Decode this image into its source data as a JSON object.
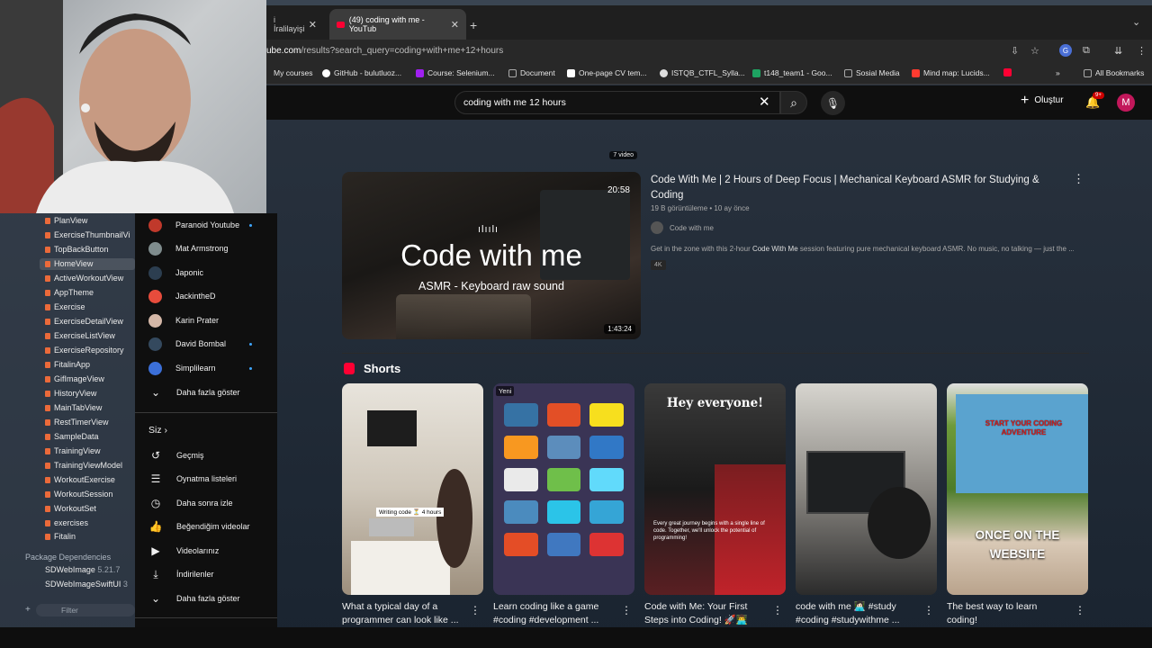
{
  "browser": {
    "tabs": [
      {
        "label": "i İralilayişi"
      },
      {
        "label": "(49) coding with me - YouTub"
      }
    ],
    "url_prefix": "ube.com",
    "url_rest": "/results?search_query=coding+with+me+12+hours",
    "bookmarks": [
      {
        "label": "My courses",
        "color": "#c7c7c7"
      },
      {
        "label": "GitHub - bulutluoz...",
        "color": "#ffffff"
      },
      {
        "label": "Course: Selenium...",
        "color": "#a020f0"
      },
      {
        "label": "Document",
        "color": "#888888"
      },
      {
        "label": "One-page CV tem...",
        "color": "#ffffff"
      },
      {
        "label": "ISTQB_CTFL_Sylla...",
        "color": "#e0e0e0"
      },
      {
        "label": "t148_team1 - Goo...",
        "color": "#1ea362"
      },
      {
        "label": "Sosial Media",
        "color": "#888888"
      },
      {
        "label": "Mind map: Lucids...",
        "color": "#ff3b30"
      },
      {
        "label": "All Bookmarks",
        "color": "#888888"
      }
    ]
  },
  "header": {
    "search_value": "coding with me 12 hours",
    "create_label": "Oluştur",
    "notif_count": "9+",
    "account_initial": "M"
  },
  "xcode": {
    "items": [
      "PlanView",
      "ExerciseThumbnailVi",
      "TopBackButton",
      "HomeView",
      "ActiveWorkoutView",
      "AppTheme",
      "Exercise",
      "ExerciseDetailView",
      "ExerciseListView",
      "ExerciseRepository",
      "FitalinApp",
      "GifImageView",
      "HistoryView",
      "MainTabView",
      "RestTimerView",
      "SampleData",
      "TrainingView",
      "TrainingViewModel",
      "WorkoutExercise",
      "WorkoutSession",
      "WorkoutSet",
      "exercises",
      "Fitalin"
    ],
    "package_deps_label": "Package Dependencies",
    "packages": [
      {
        "name": "SDWebImage",
        "version": "5.21.7"
      },
      {
        "name": "SDWebImageSwiftUI",
        "version": "3"
      }
    ],
    "filter_placeholder": "Filter"
  },
  "sidebar": {
    "subscriptions": [
      {
        "label": "Paranoid Youtube",
        "color": "#c0392b",
        "dot": true
      },
      {
        "label": "Mat Armstrong",
        "color": "#7f8c8d",
        "dot": false
      },
      {
        "label": "Japonic",
        "color": "#2c3e50",
        "dot": false
      },
      {
        "label": "JackintheD",
        "color": "#e74c3c",
        "dot": false
      },
      {
        "label": "Karin Prater",
        "color": "#d5b8a8",
        "dot": false
      },
      {
        "label": "David Bombal",
        "color": "#34495e",
        "dot": true
      },
      {
        "label": "Simplilearn",
        "color": "#3b6fd8",
        "dot": true
      }
    ],
    "show_more": "Daha fazla göster",
    "you_label": "Siz",
    "you_items": [
      {
        "label": "Geçmiş",
        "icon": "history-icon"
      },
      {
        "label": "Oynatma listeleri",
        "icon": "playlist-icon"
      },
      {
        "label": "Daha sonra izle",
        "icon": "clock-icon"
      },
      {
        "label": "Beğendiğim videolar",
        "icon": "thumbs-up-icon"
      },
      {
        "label": "Videolarınız",
        "icon": "video-icon"
      },
      {
        "label": "İndirilenler",
        "icon": "download-icon"
      }
    ],
    "show_more_2": "Daha fazla göster"
  },
  "results": {
    "top_playlist_badge": "7 video",
    "video": {
      "thumb_title": "Code with me",
      "thumb_subtitle": "ASMR - Keyboard raw sound",
      "thumb_time_top": "20:58",
      "duration": "1:43:24",
      "title": "Code With Me | 2 Hours of Deep Focus | Mechanical Keyboard ASMR for Studying & Coding",
      "meta": "19 B görüntüleme • 10 ay önce",
      "channel": "Code with me",
      "desc_pre": "Get in the zone with this 2-hour ",
      "desc_bold": "Code With Me",
      "desc_post": " session featuring pure mechanical keyboard ASMR. No music, no talking — just the ...",
      "badge": "4K"
    },
    "shorts_title": "Shorts",
    "shorts": [
      {
        "title": "What a typical day of a programmer can look like ...",
        "overlay": "Writing code ⏳ 4 hours"
      },
      {
        "title": "Learn coding like a game #coding #development ...",
        "overlay": "Yeni"
      },
      {
        "title": "Code with Me: Your First Steps into Coding! 🚀👨‍💻",
        "overlay": "Hey everyone!",
        "overlay2": "Every great journey begins with a single line of code. Together, we'll unlock the potential of programming!"
      },
      {
        "title": "code with me 👩🏻‍💻 #study #coding #studywithme ...",
        "overlay": ""
      },
      {
        "title": "The best way to learn coding!",
        "overlay": "ONCE ON THE WEBSITE",
        "overlay2": "START YOUR CODING ADVENTURE"
      }
    ]
  },
  "colors": {
    "accent": "#ff0033",
    "link": "#3ea6ff"
  }
}
